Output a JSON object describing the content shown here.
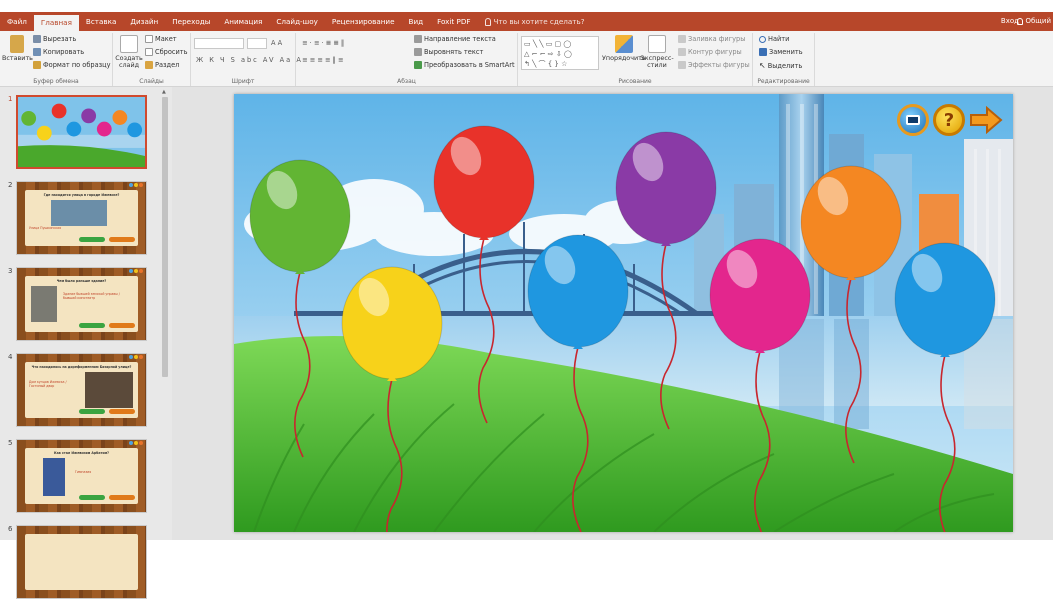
{
  "tabs": [
    "Файл",
    "Главная",
    "Вставка",
    "Дизайн",
    "Переходы",
    "Анимация",
    "Слайд-шоу",
    "Рецензирование",
    "Вид",
    "Foxit PDF"
  ],
  "tell_me": "Что вы хотите сделать?",
  "sign_in": "Вход",
  "share": "Общий",
  "ribbon": {
    "clipboard": {
      "paste": "Вставить",
      "cut": "Вырезать",
      "copy": "Копировать",
      "format": "Формат по образцу",
      "label": "Буфер обмена"
    },
    "slides": {
      "new": "Создать слайд",
      "layout": "Макет",
      "reset": "Сбросить",
      "section": "Раздел",
      "label": "Слайды"
    },
    "font": {
      "label": "Шрифт",
      "glyphs": [
        "Ж",
        "К",
        "Ч",
        "S",
        "abc",
        "AV",
        "Aa",
        "A"
      ]
    },
    "paragraph": {
      "text_dir": "Направление текста",
      "align": "Выровнять текст",
      "smartart": "Преобразовать в SmartArt",
      "label": "Абзац"
    },
    "drawing": {
      "arrange": "Упорядочить",
      "styles": "Экспресс-стили",
      "fill": "Заливка фигуры",
      "outline": "Контур фигуры",
      "effects": "Эффекты фигуры",
      "label": "Рисование"
    },
    "editing": {
      "find": "Найти",
      "replace": "Заменить",
      "select": "Выделить",
      "label": "Редактирование"
    }
  },
  "slide_numbers": [
    "1",
    "2",
    "3",
    "4",
    "5",
    "6"
  ],
  "thumbs": {
    "s2_title": "Где находится улица в городе Ижевске?",
    "s3_title": "Чем было раньше здание?",
    "s3_text": "Здание бывшей земской управы / бывший кинотеатр",
    "s4_title": "Что находилось на дореформенном Базарной улице?",
    "s4_text": "Дом купцов Ижевска / Гостиный двор",
    "s5_title": "Как стал Ижевским Арбатом?",
    "s5_text": "Гимназия",
    "s2_text": "Улица Пушкинская"
  },
  "balloons": [
    {
      "name": "green",
      "color": "#62b533"
    },
    {
      "name": "red",
      "color": "#e8322a"
    },
    {
      "name": "purple",
      "color": "#8a3aa6"
    },
    {
      "name": "orange",
      "color": "#f48722"
    },
    {
      "name": "yellow",
      "color": "#f7d21a"
    },
    {
      "name": "blue-left",
      "color": "#1f97e0"
    },
    {
      "name": "pink",
      "color": "#e3268d"
    },
    {
      "name": "blue-right",
      "color": "#1f97e0"
    }
  ],
  "slide_controls": [
    "screen-icon",
    "help-icon",
    "next-arrow-icon"
  ],
  "help_glyph": "?",
  "accent": "#b7472a"
}
